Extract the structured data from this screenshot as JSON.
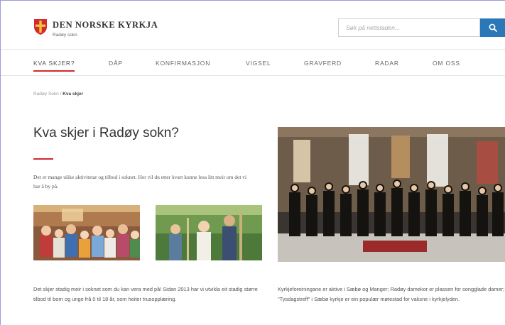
{
  "header": {
    "org_name": "DEN NORSKE KYRKJA",
    "org_sub": "Radøy sokn",
    "search_placeholder": "Søk på nettstaden..."
  },
  "nav": {
    "items": [
      {
        "label": "KVA SKJER?",
        "active": true
      },
      {
        "label": "DÅP"
      },
      {
        "label": "KONFIRMASJON"
      },
      {
        "label": "VIGSEL"
      },
      {
        "label": "GRAVFERD"
      },
      {
        "label": "RADAR"
      },
      {
        "label": "OM OSS"
      }
    ]
  },
  "breadcrumb": {
    "root": "Radøy Sokn",
    "separator": " / ",
    "current": "Kva skjer"
  },
  "main": {
    "title": "Kva skjer i Radøy sokn?",
    "intro": "Det er mange ulike aktivitetar og tilbod i soknet. Her vil du etter kvart kunne lesa litt meir om det vi har å by på.",
    "caption_left": "Det skjer stadig meir i soknet som du kan vera med på! Sidan 2013 har vi utvikla eit stadig større tilbod til born og unge frå 0 til 18 år, som heiter trusopplæring.",
    "caption_right": "Kyrkjeforeiningane er aktive i Sæbø og Manger; Radøy damekor er plassen for songglade damer; \"Tysdagstreff\" i Sæbø kyrkje er ein populær møtestad for vaksne i kyrkjelyden."
  },
  "colors": {
    "accent_red": "#d02b2e",
    "search_blue": "#2a78b7",
    "frame_border": "#9a9ad8"
  },
  "icons": {
    "logo": "church-shield-logo-icon",
    "search": "search-icon"
  }
}
